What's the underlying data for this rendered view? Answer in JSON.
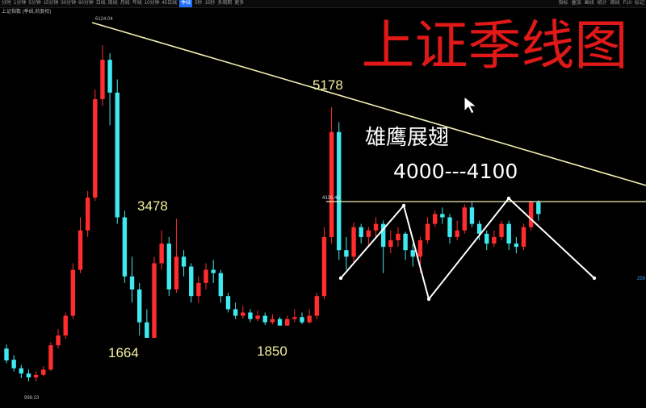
{
  "toolbar": {
    "periods": [
      "分时",
      "1分钟",
      "5分钟",
      "15分钟",
      "30分钟",
      "60分钟",
      "日线",
      "周线",
      "月线",
      "年线",
      "10分钟",
      "45日线",
      "季线",
      "5秒",
      "15秒",
      "多周期",
      "更多"
    ],
    "active_period": "季线",
    "tools": [
      "指标",
      "叠加",
      "画线",
      "统计",
      "周线",
      "F10",
      "标记"
    ]
  },
  "subtitle": "上证指数 (季线,前复权)",
  "title": "上证季线图",
  "annotations": {
    "pattern": "雄鹰展翅",
    "range": "4000---4100",
    "peaks": [
      {
        "id": "peak-5178",
        "text": "5178"
      },
      {
        "id": "peak-3478",
        "text": "3478"
      },
      {
        "id": "low-1664",
        "text": "1664"
      },
      {
        "id": "low-1850",
        "text": "1850"
      }
    ],
    "chart_labels": {
      "high": "6124.04",
      "low": "998.23",
      "line": "4136.48",
      "right_edge": "259"
    }
  },
  "colors": {
    "up": "#ff2d2d",
    "down": "#40e8f0",
    "trendline": "#f2eeb0",
    "zigzag": "#ffffff",
    "title": "#e01818",
    "background": "#000000"
  },
  "chart_data": {
    "type": "candlestick",
    "y_scale": "approx linear, index points",
    "candles": [
      [
        1500,
        1320,
        1560,
        1280
      ],
      [
        1330,
        1200,
        1400,
        1150
      ],
      [
        1200,
        1120,
        1250,
        1050
      ],
      [
        1120,
        1060,
        1180,
        1000
      ],
      [
        1060,
        1100,
        1150,
        998
      ],
      [
        1100,
        1180,
        1230,
        1080
      ],
      [
        1180,
        1550,
        1600,
        1160
      ],
      [
        1550,
        1700,
        1800,
        1500
      ],
      [
        1700,
        2000,
        2050,
        1650
      ],
      [
        2000,
        2700,
        2800,
        1950
      ],
      [
        2700,
        3300,
        3500,
        2650
      ],
      [
        3300,
        3800,
        3900,
        3200
      ],
      [
        3800,
        5300,
        5450,
        3750
      ],
      [
        5300,
        5900,
        6124,
        5200
      ],
      [
        5900,
        5400,
        6000,
        4900
      ],
      [
        5400,
        3500,
        5600,
        3400
      ],
      [
        3500,
        2600,
        3600,
        2500
      ],
      [
        2600,
        2400,
        2900,
        2200
      ],
      [
        2400,
        1900,
        2500,
        1700
      ],
      [
        1900,
        1664,
        2100,
        1664
      ],
      [
        1664,
        2800,
        2900,
        1664
      ],
      [
        2800,
        3100,
        3300,
        2700
      ],
      [
        3100,
        2400,
        3200,
        2300
      ],
      [
        2400,
        2900,
        3478,
        2350
      ],
      [
        2900,
        2750,
        3000,
        2600
      ],
      [
        2750,
        2300,
        2800,
        2200
      ],
      [
        2300,
        2500,
        2600,
        2200
      ],
      [
        2500,
        2700,
        2800,
        2400
      ],
      [
        2700,
        2650,
        2850,
        2500
      ],
      [
        2650,
        2300,
        2700,
        2200
      ],
      [
        2300,
        2100,
        2350,
        2050
      ],
      [
        2100,
        2000,
        2200,
        1950
      ],
      [
        2000,
        2050,
        2150,
        1960
      ],
      [
        2050,
        1950,
        2100,
        1900
      ],
      [
        1950,
        2000,
        2080,
        1920
      ],
      [
        2000,
        1900,
        2050,
        1860
      ],
      [
        1900,
        1950,
        2020,
        1870
      ],
      [
        1950,
        1850,
        1980,
        1850
      ],
      [
        1850,
        1950,
        2000,
        1849
      ],
      [
        1950,
        1980,
        2100,
        1900
      ],
      [
        1980,
        1900,
        2050,
        1870
      ],
      [
        1900,
        2000,
        2100,
        1880
      ],
      [
        2000,
        2300,
        2350,
        1950
      ],
      [
        2300,
        3200,
        3350,
        2250
      ],
      [
        3200,
        4800,
        5178,
        3100
      ],
      [
        4800,
        3000,
        4950,
        2850
      ],
      [
        3000,
        2900,
        3200,
        2700
      ],
      [
        2900,
        3350,
        3420,
        2800
      ],
      [
        3350,
        3200,
        3400,
        3100
      ],
      [
        3200,
        3300,
        3350,
        3050
      ],
      [
        3300,
        3400,
        3500,
        3200
      ],
      [
        3400,
        3050,
        3450,
        2650
      ],
      [
        3050,
        3150,
        3300,
        2950
      ],
      [
        3150,
        3250,
        3350,
        3050
      ],
      [
        3250,
        3000,
        3280,
        2850
      ],
      [
        3000,
        2900,
        3100,
        2750
      ],
      [
        2900,
        3150,
        3200,
        2650
      ],
      [
        3150,
        3400,
        3500,
        3100
      ],
      [
        3400,
        3550,
        3600,
        3350
      ],
      [
        3550,
        3500,
        3650,
        3400
      ],
      [
        3500,
        3200,
        3550,
        3100
      ],
      [
        3200,
        3300,
        3450,
        3150
      ],
      [
        3300,
        3650,
        3700,
        3250
      ],
      [
        3650,
        3400,
        3732,
        3350
      ],
      [
        3400,
        3250,
        3450,
        3150
      ],
      [
        3250,
        3100,
        3300,
        3000
      ],
      [
        3100,
        3200,
        3300,
        3050
      ],
      [
        3200,
        3400,
        3450,
        3150
      ],
      [
        3400,
        3100,
        3450,
        3000
      ],
      [
        3100,
        3050,
        3200,
        2950
      ],
      [
        3050,
        3350,
        3400,
        3000
      ],
      [
        3350,
        3730,
        3750,
        3300
      ],
      [
        3730,
        3550,
        3760,
        3450
      ]
    ],
    "candle_format": [
      "open",
      "close",
      "high",
      "low"
    ],
    "zigzag": [
      {
        "index": 47,
        "value": 2850
      },
      {
        "index": 56,
        "value": 3650
      },
      {
        "index": 60,
        "value": 2550
      },
      {
        "index": 70,
        "value": 3720
      },
      {
        "index": 81,
        "value": 2700
      }
    ],
    "lines": [
      {
        "name": "trendline",
        "from": {
          "index": 13,
          "value": 6124
        },
        "to": {
          "index": 84,
          "value": 4200
        }
      },
      {
        "name": "horizontal",
        "value": 3700
      }
    ],
    "labels": [
      {
        "text": "5178",
        "index": 44,
        "value": 5178
      },
      {
        "text": "3478",
        "index": 23,
        "value": 3478
      },
      {
        "text": "1664",
        "index": 19,
        "value": 1664
      },
      {
        "text": "1850",
        "index": 37,
        "value": 1850
      }
    ]
  }
}
